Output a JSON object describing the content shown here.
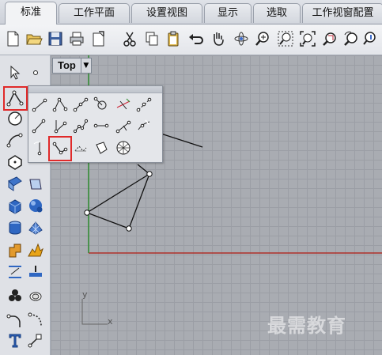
{
  "tabs": [
    {
      "label": "标准",
      "active": true
    },
    {
      "label": "工作平面",
      "active": false
    },
    {
      "label": "设置视图",
      "active": false
    },
    {
      "label": "显示",
      "active": false
    },
    {
      "label": "选取",
      "active": false
    },
    {
      "label": "工作视窗配置",
      "active": false
    }
  ],
  "toolbar": {
    "icons": [
      "new-file-icon",
      "open-folder-icon",
      "save-icon",
      "print-icon",
      "import-icon",
      "cut-icon",
      "copy-icon",
      "paste-icon",
      "undo-icon",
      "pan-hand-icon",
      "rotate-view-icon",
      "zoom-icon",
      "zoom-window-icon",
      "zoom-extents-icon",
      "zoom-selected-icon",
      "redo-view-icon"
    ]
  },
  "viewport": {
    "name": "Top",
    "dropdown_glyph": "▼",
    "axis_x": "x",
    "axis_y": "y",
    "accent_x_axis": "#b0302a",
    "accent_y_axis": "#2e8b2e"
  },
  "highlight_color": "#e02a2a",
  "watermark": "最需教育"
}
